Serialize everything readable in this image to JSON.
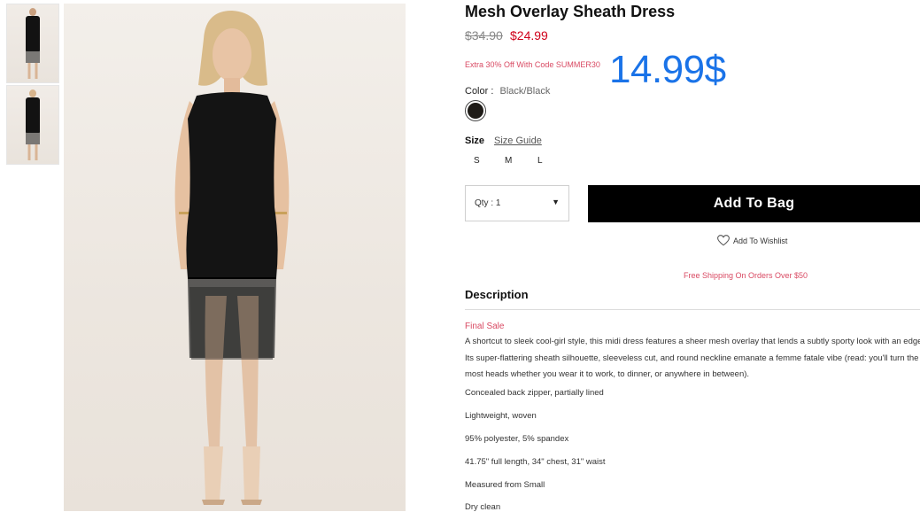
{
  "product": {
    "title": "Mesh Overlay Sheath Dress",
    "original_price": "$34.90",
    "sale_price": "$24.99",
    "promo": "Extra 30% Off With Code SUMMER30",
    "overlay_price": "14.99$"
  },
  "color": {
    "label": "Color",
    "separator": ":",
    "value": "Black/Black",
    "swatch": "#1e1b17"
  },
  "size": {
    "label": "Size",
    "guide_label": "Size Guide",
    "options": [
      "S",
      "M",
      "L"
    ]
  },
  "cart": {
    "qty_label": "Qty : 1",
    "qty_caret": "▼",
    "add_to_bag": "Add To Bag",
    "wishlist": "Add To Wishlist",
    "free_shipping": "Free Shipping On Orders Over $50"
  },
  "description": {
    "heading": "Description",
    "final_sale": "Final Sale",
    "body": "A shortcut to sleek cool-girl style, this midi dress features a sheer mesh overlay that lends a subtly sporty look with an edge. Its super-flattering sheath silhouette, sleeveless cut, and round neckline emanate a femme fatale vibe (read: you'll turn the most heads whether you wear it to work, to dinner, or anywhere in between).",
    "details": [
      "Concealed back zipper, partially lined",
      "Lightweight, woven",
      "95% polyester, 5% spandex",
      "41.75\" full length, 34\" chest, 31\" waist",
      "Measured from Small",
      "Dry clean"
    ]
  },
  "colors": {
    "accent_red": "#d94a63",
    "sale_red": "#d0021b",
    "overlay_blue": "#1a73e8"
  }
}
